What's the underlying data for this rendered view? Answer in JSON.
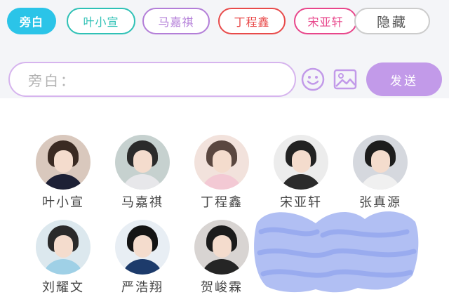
{
  "tabs": [
    {
      "label": "旁白",
      "color": "#2bc4e8",
      "active": true
    },
    {
      "label": "叶小宣",
      "color": "#2fc1b6",
      "active": false
    },
    {
      "label": "马嘉祺",
      "color": "#b37ed8",
      "active": false
    },
    {
      "label": "丁程鑫",
      "color": "#e84a4a",
      "active": false
    },
    {
      "label": "宋亚轩",
      "color": "#e8468b",
      "active": false
    }
  ],
  "hide_button": {
    "label": "隐藏",
    "color": "#cccccc"
  },
  "composer": {
    "placeholder": "旁白：",
    "emoji_icon": "smile-icon",
    "image_icon": "image-icon",
    "send_label": "发送",
    "accent": "#c29ae9"
  },
  "characters": [
    {
      "name": "叶小宣",
      "hair": "#3a2a22",
      "top": "#1d2035",
      "bg": "#d9c8bd"
    },
    {
      "name": "马嘉祺",
      "hair": "#2b2b2b",
      "top": "#e7e7ea",
      "bg": "#c6d1cf"
    },
    {
      "name": "丁程鑫",
      "hair": "#5a4740",
      "top": "#f3c9d4",
      "bg": "#f2e2dc"
    },
    {
      "name": "宋亚轩",
      "hair": "#222222",
      "top": "#2b2b2b",
      "bg": "#ececec"
    },
    {
      "name": "张真源",
      "hair": "#1d1d1d",
      "top": "#f0f0f0",
      "bg": "#d5d8de"
    },
    {
      "name": "刘耀文",
      "hair": "#2a2a2a",
      "top": "#9fd0e6",
      "bg": "#dce8ee"
    },
    {
      "name": "严浩翔",
      "hair": "#141414",
      "top": "#1d3b6b",
      "bg": "#e8eef4"
    },
    {
      "name": "贺峻霖",
      "hair": "#1b1b1b",
      "top": "#252525",
      "bg": "#d8d4d2"
    }
  ],
  "redaction_color": "#a8b8f2"
}
